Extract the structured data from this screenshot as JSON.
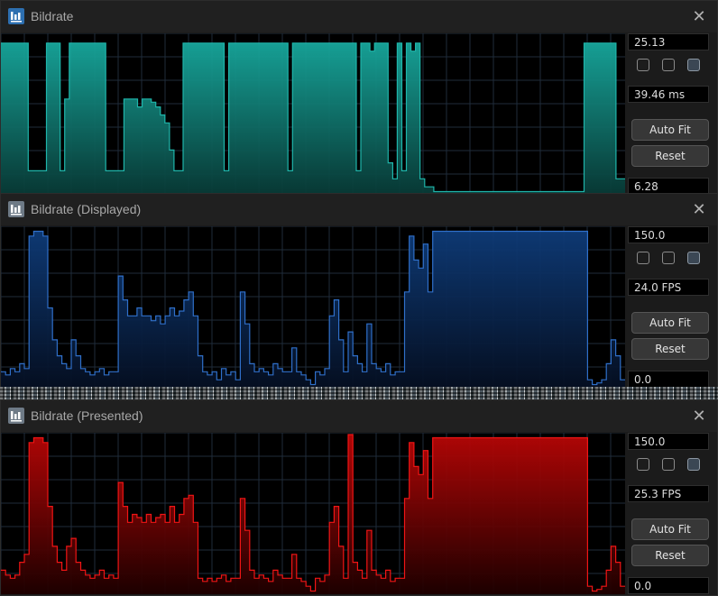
{
  "windows": [
    {
      "title": "Bildrate",
      "max_value": "25.13",
      "current_value": "39.46 ms",
      "min_value": "6.28",
      "auto_fit_label": "Auto Fit",
      "reset_label": "Reset",
      "checkboxes": [
        false,
        false,
        true
      ],
      "fill_color_top": "#17a79c",
      "fill_color_bottom": "#083a36",
      "line_color": "#1fb5aa",
      "samples": [
        0.95,
        0.95,
        0.95,
        0.95,
        0.95,
        0.95,
        0.15,
        0.15,
        0.15,
        0.15,
        0.95,
        0.95,
        0.95,
        0.15,
        0.6,
        0.95,
        0.95,
        0.95,
        0.95,
        0.95,
        0.95,
        0.95,
        0.95,
        0.15,
        0.15,
        0.15,
        0.15,
        0.6,
        0.6,
        0.6,
        0.55,
        0.6,
        0.6,
        0.58,
        0.55,
        0.5,
        0.45,
        0.28,
        0.15,
        0.15,
        0.95,
        0.95,
        0.95,
        0.95,
        0.95,
        0.95,
        0.95,
        0.95,
        0.95,
        0.15,
        0.95,
        0.95,
        0.95,
        0.95,
        0.95,
        0.95,
        0.95,
        0.95,
        0.95,
        0.95,
        0.95,
        0.95,
        0.95,
        0.15,
        0.95,
        0.95,
        0.95,
        0.95,
        0.95,
        0.95,
        0.95,
        0.95,
        0.95,
        0.95,
        0.95,
        0.95,
        0.95,
        0.95,
        0.15,
        0.95,
        0.95,
        0.9,
        0.95,
        0.95,
        0.95,
        0.2,
        0.1,
        0.95,
        0.15,
        0.95,
        0.9,
        0.95,
        0.1,
        0.05,
        0.05,
        0.02,
        0.02,
        0.02,
        0.02,
        0.02,
        0.02,
        0.02,
        0.02,
        0.02,
        0.02,
        0.02,
        0.02,
        0.02,
        0.02,
        0.02,
        0.02,
        0.02,
        0.02,
        0.02,
        0.02,
        0.02,
        0.02,
        0.02,
        0.02,
        0.02,
        0.02,
        0.02,
        0.02,
        0.02,
        0.02,
        0.02,
        0.02,
        0.02,
        0.95,
        0.95,
        0.95,
        0.95,
        0.95,
        0.95,
        0.95,
        0.1,
        0.1
      ]
    },
    {
      "title": "Bildrate (Displayed)",
      "max_value": "150.0",
      "current_value": "24.0 FPS",
      "min_value": "0.0",
      "auto_fit_label": "Auto Fit",
      "reset_label": "Reset",
      "checkboxes": [
        false,
        false,
        true
      ],
      "fill_color_top": "#0e3b78",
      "fill_color_bottom": "#050f22",
      "line_color": "#2f6fc9",
      "samples": [
        0.1,
        0.08,
        0.12,
        0.1,
        0.15,
        0.12,
        0.95,
        0.98,
        0.98,
        0.95,
        0.5,
        0.3,
        0.2,
        0.15,
        0.12,
        0.3,
        0.2,
        0.12,
        0.1,
        0.08,
        0.1,
        0.12,
        0.08,
        0.1,
        0.1,
        0.7,
        0.55,
        0.45,
        0.45,
        0.5,
        0.45,
        0.45,
        0.42,
        0.45,
        0.4,
        0.45,
        0.5,
        0.45,
        0.48,
        0.55,
        0.6,
        0.45,
        0.2,
        0.1,
        0.08,
        0.1,
        0.05,
        0.12,
        0.08,
        0.1,
        0.05,
        0.6,
        0.4,
        0.15,
        0.1,
        0.12,
        0.1,
        0.08,
        0.15,
        0.12,
        0.1,
        0.1,
        0.25,
        0.1,
        0.08,
        0.05,
        0.02,
        0.1,
        0.08,
        0.12,
        0.45,
        0.55,
        0.3,
        0.1,
        0.35,
        0.2,
        0.15,
        0.1,
        0.4,
        0.15,
        0.12,
        0.1,
        0.15,
        0.08,
        0.1,
        0.1,
        0.6,
        0.95,
        0.8,
        0.75,
        0.9,
        0.6,
        0.98,
        0.98,
        0.98,
        0.98,
        0.98,
        0.98,
        0.98,
        0.98,
        0.98,
        0.98,
        0.98,
        0.98,
        0.98,
        0.98,
        0.98,
        0.98,
        0.98,
        0.98,
        0.98,
        0.98,
        0.98,
        0.98,
        0.98,
        0.98,
        0.98,
        0.98,
        0.98,
        0.98,
        0.98,
        0.98,
        0.98,
        0.98,
        0.98,
        0.05,
        0.02,
        0.03,
        0.05,
        0.15,
        0.3,
        0.2,
        0.05
      ]
    },
    {
      "title": "Bildrate (Presented)",
      "max_value": "150.0",
      "current_value": "25.3 FPS",
      "min_value": "0.0",
      "auto_fit_label": "Auto Fit",
      "reset_label": "Reset",
      "checkboxes": [
        false,
        false,
        true
      ],
      "fill_color_top": "#b80606",
      "fill_color_bottom": "#1e0000",
      "line_color": "#f01515",
      "samples": [
        0.15,
        0.12,
        0.1,
        0.12,
        0.2,
        0.25,
        0.95,
        0.98,
        0.98,
        0.95,
        0.55,
        0.3,
        0.2,
        0.15,
        0.3,
        0.35,
        0.2,
        0.15,
        0.12,
        0.1,
        0.12,
        0.15,
        0.1,
        0.12,
        0.1,
        0.7,
        0.55,
        0.45,
        0.5,
        0.48,
        0.45,
        0.5,
        0.45,
        0.48,
        0.5,
        0.45,
        0.55,
        0.45,
        0.5,
        0.6,
        0.62,
        0.45,
        0.1,
        0.08,
        0.1,
        0.08,
        0.1,
        0.12,
        0.08,
        0.1,
        0.1,
        0.6,
        0.4,
        0.15,
        0.1,
        0.12,
        0.1,
        0.08,
        0.15,
        0.12,
        0.1,
        0.1,
        0.25,
        0.1,
        0.08,
        0.05,
        0.02,
        0.1,
        0.08,
        0.12,
        0.45,
        0.55,
        0.3,
        0.1,
        1.0,
        0.2,
        0.15,
        0.1,
        0.4,
        0.15,
        0.12,
        0.1,
        0.15,
        0.08,
        0.1,
        0.1,
        0.6,
        0.95,
        0.8,
        0.75,
        0.9,
        0.6,
        0.98,
        0.98,
        0.98,
        0.98,
        0.98,
        0.98,
        0.98,
        0.98,
        0.98,
        0.98,
        0.98,
        0.98,
        0.98,
        0.98,
        0.98,
        0.98,
        0.98,
        0.98,
        0.98,
        0.98,
        0.98,
        0.98,
        0.98,
        0.98,
        0.98,
        0.98,
        0.98,
        0.98,
        0.98,
        0.98,
        0.98,
        0.98,
        0.98,
        0.05,
        0.02,
        0.03,
        0.05,
        0.15,
        0.3,
        0.2,
        0.05
      ]
    }
  ],
  "colors": {
    "grid": "#1f2c3a",
    "panel_bg": "#000000"
  }
}
